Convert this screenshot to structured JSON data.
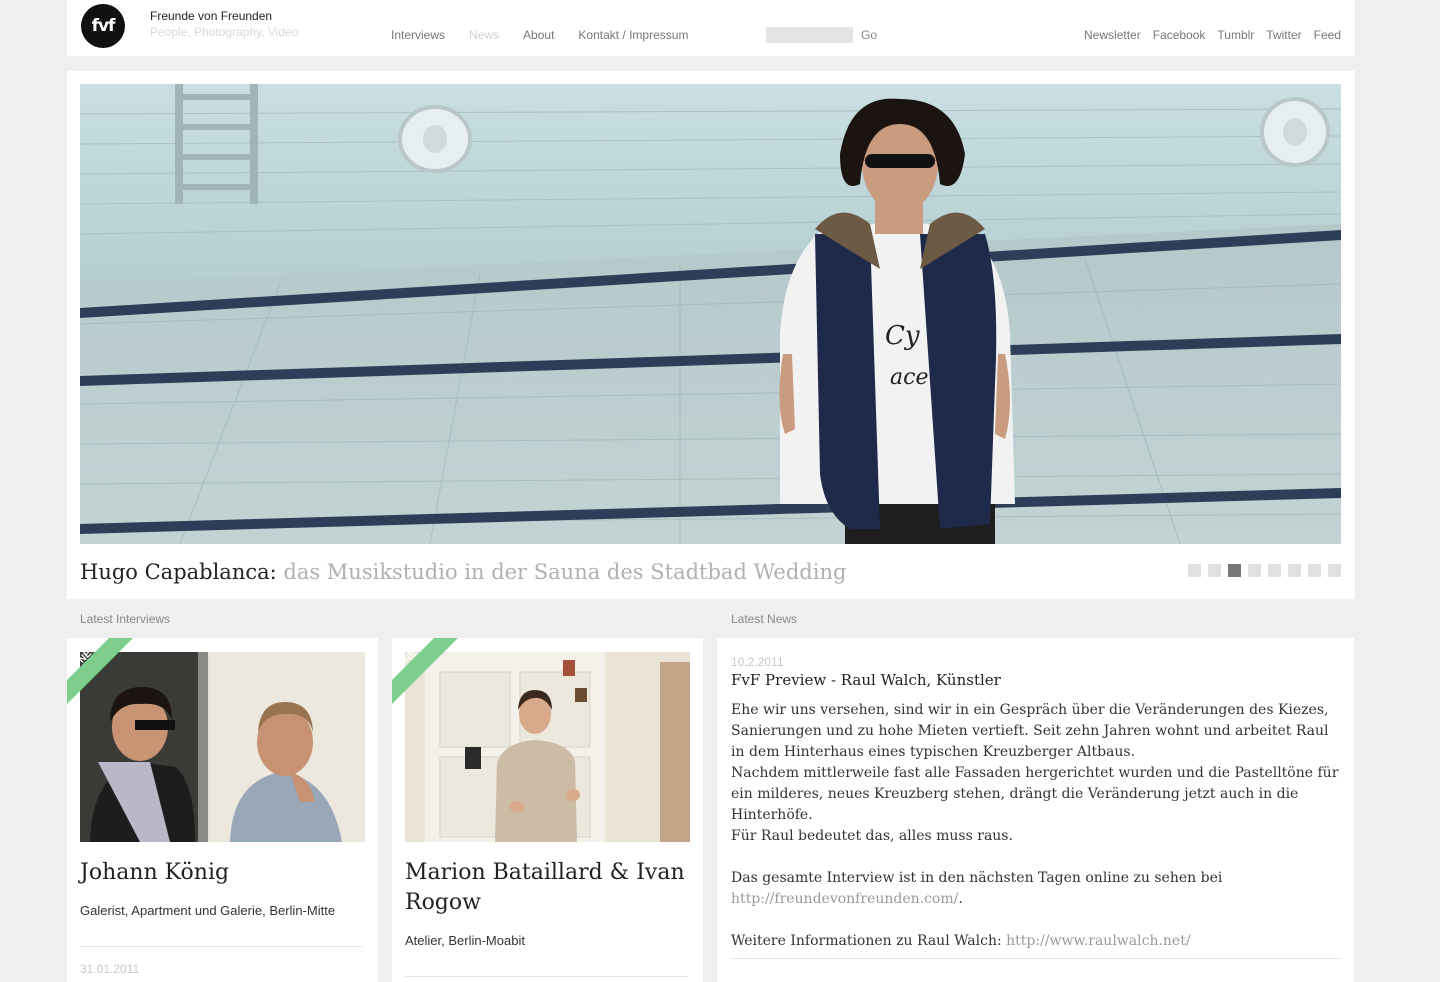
{
  "header": {
    "logo_text": "fvf",
    "site_title": "Freunde von Freunden",
    "tagline": "People, Photography, Video",
    "nav": [
      "Interviews",
      "News",
      "About",
      "Kontakt / Impressum"
    ],
    "nav_active": "News",
    "search_placeholder": "",
    "search_button": "Go",
    "social": [
      "Newsletter",
      "Facebook",
      "Tumblr",
      "Twitter",
      "Feed"
    ]
  },
  "hero": {
    "name": "Hugo Capablanca:",
    "subtitle": " das Musikstudio in der Sauna des Stadtbad Wedding",
    "slide_count": 8,
    "active_slide": 3
  },
  "sections": {
    "interviews_label": "Latest Interviews",
    "news_label": "Latest News"
  },
  "interviews": [
    {
      "badge": "NEW",
      "title": "Johann König",
      "description": "Galerist, Apartment und Galerie, Berlin-Mitte",
      "date": "31.01.2011"
    },
    {
      "badge": "NEW",
      "title": "Marion Bataillard & Ivan Rogow",
      "description": "Atelier, Berlin-Moabit",
      "date": ""
    }
  ],
  "news": {
    "date": "10.2.2011",
    "title": "FvF Preview - Raul Walch, Künstler",
    "p1": "Ehe wir uns versehen, sind wir in ein Gespräch über die Veränderungen des Kiezes, Sanierungen und zu hohe Mieten vertieft. Seit zehn Jahren wohnt und arbeitet Raul in dem Hinterhaus eines typischen Kreuzberger Altbaus.",
    "p2": "Nachdem mittlerweile fast alle Fassaden hergerichtet wurden und die Pastelltöne für ein milderes, neues Kreuzberg stehen, drängt die Veränderung jetzt auch in die Hinterhöfe.",
    "p3": "Für Raul bedeutet das, alles muss raus.",
    "p4_text": "Das gesamte Interview ist in den nächsten Tagen online zu sehen bei",
    "p4_link": "http://freundevonfreunden.com/",
    "p4_end": ".",
    "p5_text": "Weitere Informationen zu Raul Walch: ",
    "p5_link": "http://www.raulwalch.net/"
  },
  "colors": {
    "background": "#efefef",
    "ribbon": "#7ecf8e",
    "muted_text": "#b0b0b0"
  }
}
